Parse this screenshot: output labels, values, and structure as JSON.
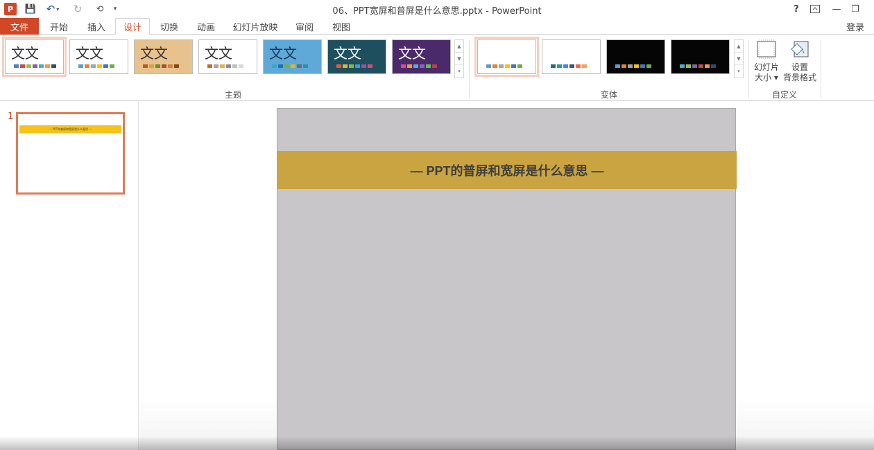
{
  "window": {
    "title": "06、PPT宽屏和普屏是什么意思.pptx - PowerPoint",
    "help": "?",
    "ribbon_display_icon": "ribbon-display-icon",
    "minimize": "—",
    "restore": "❐",
    "close": "✕"
  },
  "quick_access": {
    "app_logo": "P",
    "save": "💾",
    "undo": "↶",
    "undo_dropdown": "▾",
    "redo": "↻",
    "present": "⟲",
    "more": "▾"
  },
  "tabs": [
    {
      "label": "文件"
    },
    {
      "label": "开始"
    },
    {
      "label": "插入"
    },
    {
      "label": "设计"
    },
    {
      "label": "切换"
    },
    {
      "label": "动画"
    },
    {
      "label": "幻灯片放映"
    },
    {
      "label": "审阅"
    },
    {
      "label": "视图"
    }
  ],
  "login": "登录",
  "ribbon": {
    "themes_group": {
      "label": "主题",
      "items": [
        {
          "text": "文文",
          "bg": "#ffffff",
          "swatches": [
            "#4f81bd",
            "#c0504d",
            "#9bbb59",
            "#8064a2",
            "#4bacc6",
            "#f79646",
            "#2c4d75"
          ]
        },
        {
          "text": "文文",
          "bg": "#ffffff",
          "swatches": [
            "#5b9bd5",
            "#ed7d31",
            "#a5a5a5",
            "#ffc000",
            "#4472c4",
            "#70ad47"
          ]
        },
        {
          "text": "文文",
          "bg": "#e8c28e",
          "swatches": [
            "#b85a1f",
            "#d4a537",
            "#6b8e23",
            "#a0522d",
            "#cd853f",
            "#8b4513"
          ]
        },
        {
          "text": "文文",
          "bg": "#ffffff",
          "swatches": [
            "#c86a28",
            "#a5a5a5",
            "#e0b34a",
            "#8c8c8c",
            "#c0c0c0",
            "#d9d9d9"
          ]
        },
        {
          "text": "文文",
          "bg": "#5ea9d8",
          "swatches": [
            "#3aa5c6",
            "#1f6fb2",
            "#72b043",
            "#e6b323",
            "#6c6c6c",
            "#2f8f9d"
          ]
        },
        {
          "text": "文文",
          "bg": "#1e4f5f",
          "swatches": [
            "#e25e3a",
            "#ddb53a",
            "#8dba3c",
            "#3c9bd8",
            "#9b4f9e",
            "#d94b77"
          ]
        },
        {
          "text": "文文",
          "bg": "#4a2a6a",
          "swatches": [
            "#e04a8a",
            "#f0a030",
            "#50b0e0",
            "#8a60c0",
            "#60c060",
            "#c04040"
          ]
        }
      ]
    },
    "variants_group": {
      "label": "变体",
      "items": [
        {
          "bg": "#ffffff",
          "swatches": [
            "#5b9bd5",
            "#ed7d31",
            "#a5a5a5",
            "#ffc000",
            "#4472c4",
            "#70ad47"
          ]
        },
        {
          "bg": "#ffffff",
          "swatches": [
            "#1f6f8b",
            "#2a9d8f",
            "#3a86ff",
            "#4a4e69",
            "#e76f51",
            "#f4a261"
          ]
        },
        {
          "bg": "#050505",
          "swatches": [
            "#5b9bd5",
            "#ed7d31",
            "#a5a5a5",
            "#ffc000",
            "#4472c4",
            "#70ad47"
          ]
        },
        {
          "bg": "#050505",
          "swatches": [
            "#4bacc6",
            "#9bbb59",
            "#8064a2",
            "#c0504d",
            "#f79646",
            "#2c4d75"
          ]
        }
      ]
    },
    "customize_group": {
      "label": "自定义",
      "slide_size": [
        "幻灯片",
        "大小 ▾"
      ],
      "format_bg": [
        "设置",
        "背景格式"
      ]
    }
  },
  "thumbnails": [
    {
      "number": "1",
      "title": "— PPT的普屏和宽屏是什么意思 —"
    }
  ],
  "slide": {
    "title": "— PPT的普屏和宽屏是什么意思 —",
    "band_color": "#c9a441",
    "bg_color": "#c8c6c8"
  }
}
